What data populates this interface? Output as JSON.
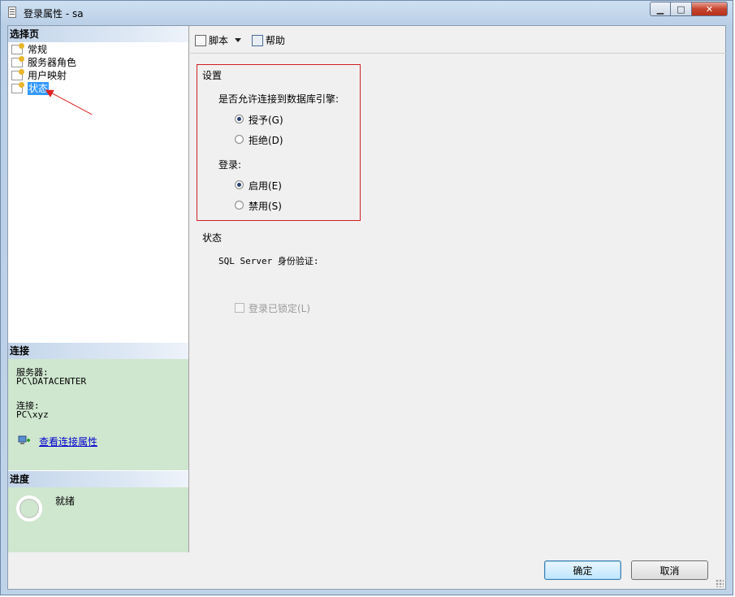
{
  "window": {
    "title": "登录属性 - sa",
    "minimize_label": "▁",
    "maximize_label": "□",
    "close_label": "✕"
  },
  "sidebar": {
    "header": "选择页",
    "items": [
      {
        "label": "常规",
        "selected": false
      },
      {
        "label": "服务器角色",
        "selected": false
      },
      {
        "label": "用户映射",
        "selected": false
      },
      {
        "label": "状态",
        "selected": true
      }
    ]
  },
  "connection": {
    "header": "连接",
    "server_label": "服务器:",
    "server_value": "PC\\DATACENTER",
    "conn_label": "连接:",
    "conn_value": "PC\\xyz",
    "link_text": "查看连接属性"
  },
  "progress": {
    "header": "进度",
    "status": "就绪"
  },
  "toolbar": {
    "script_label": "脚本",
    "help_label": "帮助"
  },
  "settings": {
    "section_title": "设置",
    "permission_question": "是否允许连接到数据库引擎:",
    "grant_label": "授予(G)",
    "deny_label": "拒绝(D)",
    "permission_value": "grant",
    "login_question": "登录:",
    "enable_label": "启用(E)",
    "disable_label": "禁用(S)",
    "login_value": "enable"
  },
  "status": {
    "section_title": "状态",
    "auth_label": "SQL Server 身份验证:",
    "locked_label": "登录已锁定(L)",
    "locked_checked": false
  },
  "buttons": {
    "ok": "确定",
    "cancel": "取消"
  },
  "colors": {
    "annotation_red": "#d02020",
    "selection_blue": "#3399ff",
    "info_panel_green": "#cfe6cf"
  }
}
